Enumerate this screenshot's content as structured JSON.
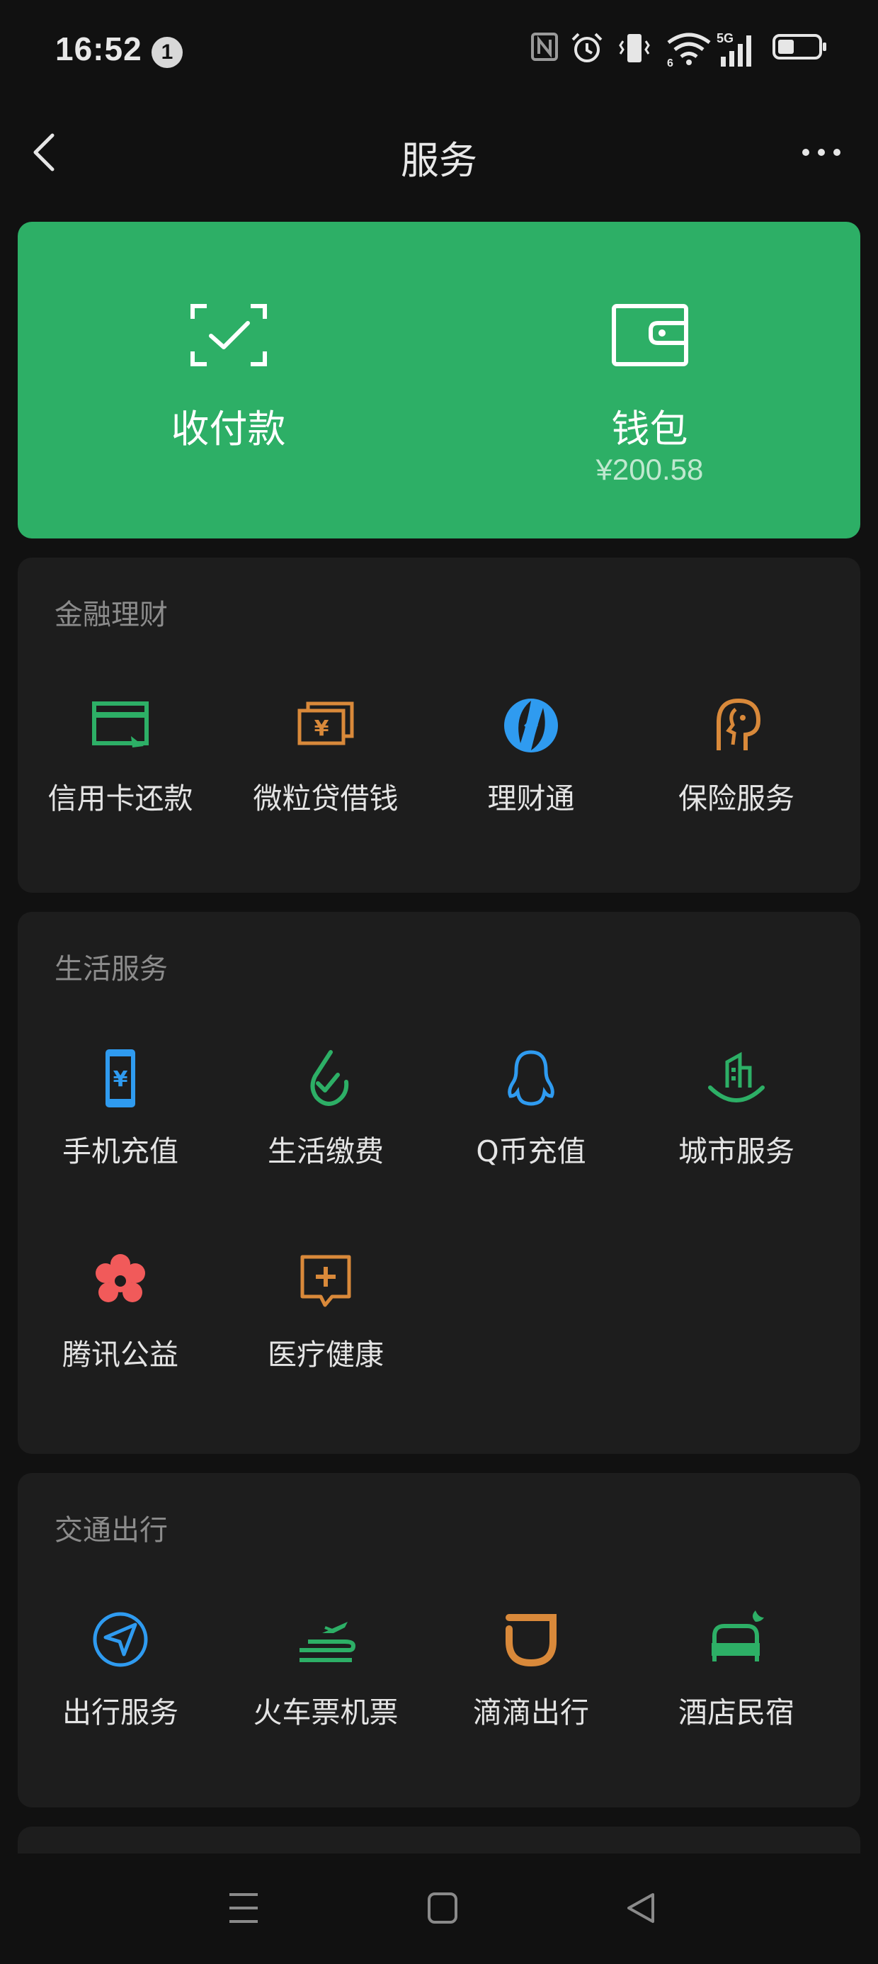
{
  "status_bar": {
    "time": "16:52",
    "notification_count": "1",
    "network": "5G",
    "signal_sub": "6"
  },
  "header": {
    "title": "服务"
  },
  "hero": {
    "pay": {
      "label": "收付款",
      "icon": "scan-check-icon"
    },
    "wallet": {
      "label": "钱包",
      "balance": "¥200.58",
      "icon": "wallet-icon"
    }
  },
  "sections": {
    "finance": {
      "title": "金融理财",
      "items": [
        {
          "label": "信用卡还款",
          "icon": "credit-card-icon",
          "color": "#2daf66"
        },
        {
          "label": "微粒贷借钱",
          "icon": "cash-icon",
          "color": "#d9893a"
        },
        {
          "label": "理财通",
          "icon": "licaitong-icon",
          "color": "#2f9bf0"
        },
        {
          "label": "保险服务",
          "icon": "insurance-icon",
          "color": "#d9893a"
        }
      ]
    },
    "life": {
      "title": "生活服务",
      "items": [
        {
          "label": "手机充值",
          "icon": "phone-recharge-icon",
          "color": "#2f9bf0"
        },
        {
          "label": "生活缴费",
          "icon": "utility-bill-icon",
          "color": "#2daf66"
        },
        {
          "label": "Q币充值",
          "icon": "qq-coin-icon",
          "color": "#2f9bf0"
        },
        {
          "label": "城市服务",
          "icon": "city-service-icon",
          "color": "#2daf66"
        },
        {
          "label": "腾讯公益",
          "icon": "charity-flower-icon",
          "color": "#f15a5a"
        },
        {
          "label": "医疗健康",
          "icon": "medical-icon",
          "color": "#d9893a"
        }
      ]
    },
    "transport": {
      "title": "交通出行",
      "items": [
        {
          "label": "出行服务",
          "icon": "navigation-icon",
          "color": "#2f9bf0"
        },
        {
          "label": "火车票机票",
          "icon": "train-plane-icon",
          "color": "#2daf66"
        },
        {
          "label": "滴滴出行",
          "icon": "didi-icon",
          "color": "#d9893a"
        },
        {
          "label": "酒店民宿",
          "icon": "hotel-bed-icon",
          "color": "#2daf66"
        }
      ]
    }
  },
  "colors": {
    "hero_bg": "#2daf66",
    "page_bg": "#111111",
    "card_bg": "#1d1d1d"
  }
}
